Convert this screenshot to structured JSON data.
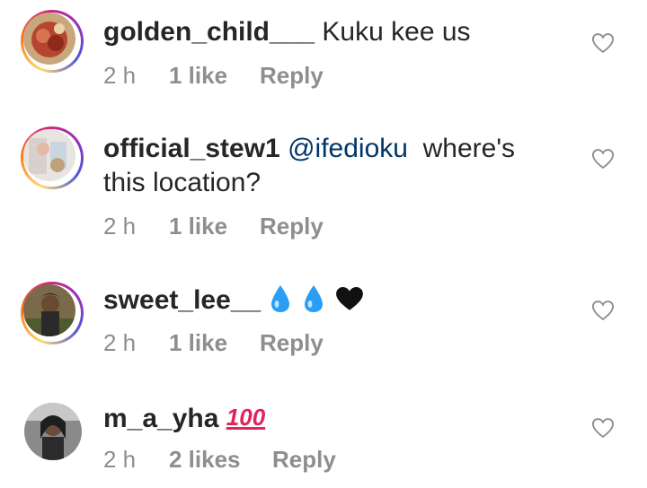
{
  "comments": [
    {
      "username": "golden_child___",
      "mention": "",
      "text": "Kuku kee us",
      "text_line2": "",
      "time": "2 h",
      "likes": "1 like",
      "reply": "Reply",
      "has_story_ring": true
    },
    {
      "username": "official_stew1",
      "mention": "@ifedioku",
      "text": "where's",
      "text_line2": "this location?",
      "time": "2 h",
      "likes": "1 like",
      "reply": "Reply",
      "has_story_ring": true
    },
    {
      "username": "sweet_lee__",
      "mention": "",
      "text": "",
      "emoji": [
        "droplet",
        "droplet",
        "black-heart"
      ],
      "time": "2 h",
      "likes": "1 like",
      "reply": "Reply",
      "has_story_ring": true
    },
    {
      "username": "m_a_yha",
      "mention": "",
      "text": "",
      "emoji": [
        "hundred-points"
      ],
      "emoji_text": "100",
      "time": "2 h",
      "likes": "2 likes",
      "reply": "Reply",
      "has_story_ring": false
    }
  ],
  "icons": {
    "like": "heart-outline-icon"
  },
  "colors": {
    "text": "#262626",
    "meta": "#8e8e8e",
    "mention": "#003569",
    "droplet": "#2a9df4",
    "hundred": "#e0245e"
  }
}
